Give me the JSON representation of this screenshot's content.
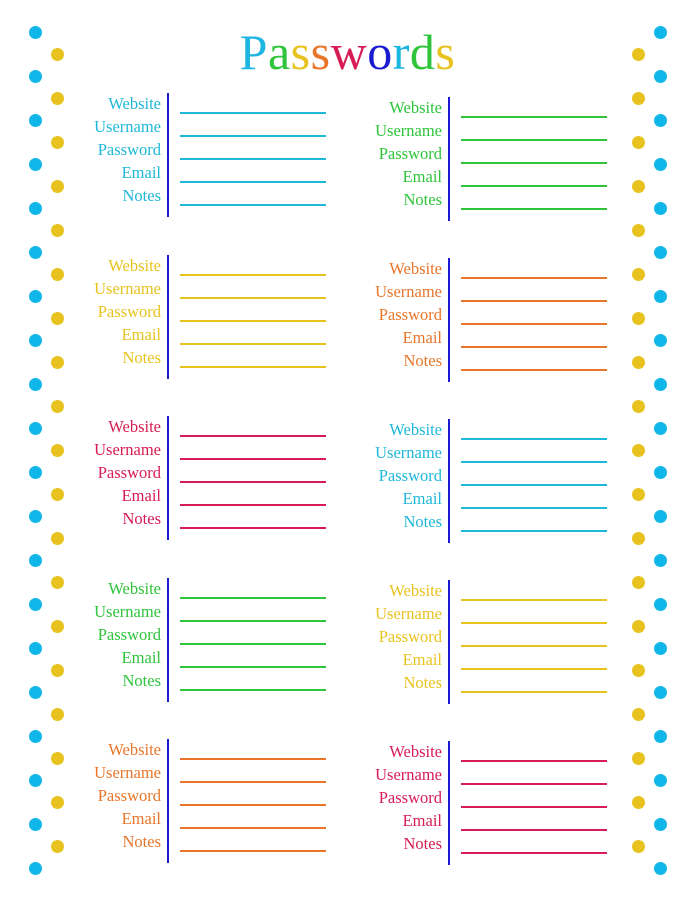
{
  "page": {
    "title": "Passwords",
    "title_letters": [
      {
        "char": "P",
        "color": "#1cb6e0"
      },
      {
        "char": "a",
        "color": "#2fc43b"
      },
      {
        "char": "s",
        "color": "#e8c320"
      },
      {
        "char": "s",
        "color": "#e8762a"
      },
      {
        "char": "w",
        "color": "#d81c55"
      },
      {
        "char": "o",
        "color": "#1a1ad0"
      },
      {
        "char": "r",
        "color": "#1cb6e0"
      },
      {
        "char": "d",
        "color": "#2fc43b"
      },
      {
        "char": "s",
        "color": "#e8c320"
      }
    ]
  },
  "colors": {
    "cyan": "#1fb8d8",
    "green": "#2fc43b",
    "yellow": "#e8c320",
    "orange": "#e8762a",
    "crimson": "#d81c55",
    "divider": "#1a1ad0",
    "dot_cyan": "#12b7ea",
    "dot_yellow": "#e8c320"
  },
  "field_labels": [
    "Website",
    "Username",
    "Password",
    "Email",
    "Notes"
  ],
  "entries": [
    {
      "column": "left",
      "row": 1,
      "color": "cyan"
    },
    {
      "column": "right",
      "row": 1,
      "color": "green"
    },
    {
      "column": "left",
      "row": 2,
      "color": "yellow"
    },
    {
      "column": "right",
      "row": 2,
      "color": "orange"
    },
    {
      "column": "left",
      "row": 3,
      "color": "crimson"
    },
    {
      "column": "right",
      "row": 3,
      "color": "cyan"
    },
    {
      "column": "left",
      "row": 4,
      "color": "green"
    },
    {
      "column": "right",
      "row": 4,
      "color": "yellow"
    },
    {
      "column": "left",
      "row": 5,
      "color": "orange"
    },
    {
      "column": "right",
      "row": 5,
      "color": "crimson"
    }
  ],
  "fields_values": {
    "Website": "",
    "Username": "",
    "Password": "",
    "Email": "",
    "Notes": ""
  },
  "decoration": {
    "border_dots": "alternating cyan and yellow polka dots down both side margins"
  }
}
